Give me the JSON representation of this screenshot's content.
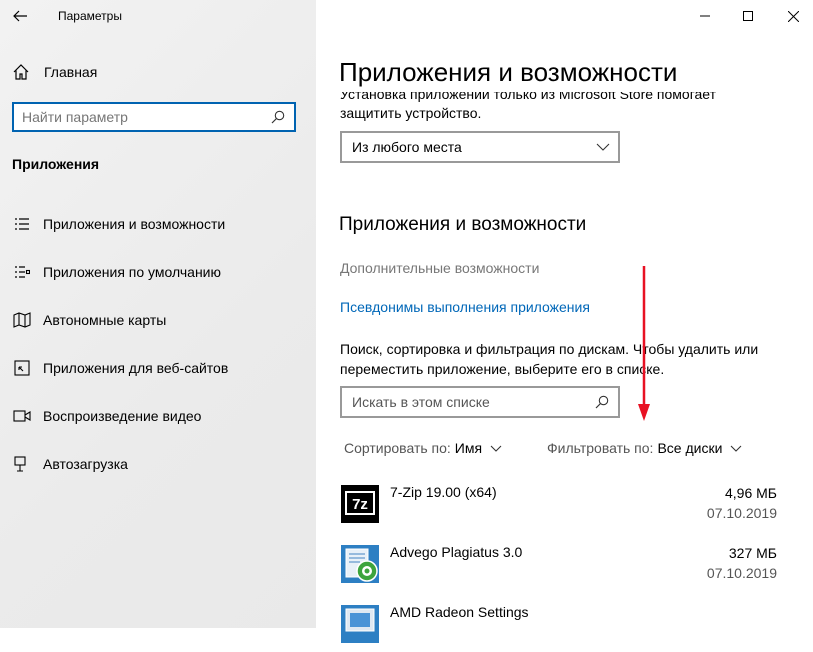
{
  "window": {
    "title": "Параметры"
  },
  "sidebar": {
    "home_label": "Главная",
    "search_placeholder": "Найти параметр",
    "section_title": "Приложения",
    "items": [
      {
        "label": "Приложения и возможности",
        "icon": "apps-list-icon"
      },
      {
        "label": "Приложения по умолчанию",
        "icon": "default-apps-icon"
      },
      {
        "label": "Автономные карты",
        "icon": "offline-maps-icon"
      },
      {
        "label": "Приложения для веб-сайтов",
        "icon": "apps-for-websites-icon"
      },
      {
        "label": "Воспроизведение видео",
        "icon": "video-playback-icon"
      },
      {
        "label": "Автозагрузка",
        "icon": "startup-icon"
      }
    ]
  },
  "main": {
    "page_title": "Приложения и возможности",
    "cut_line": "Установка приложений только из Microsoft Store помогает",
    "cut_line2": "защитить устройство.",
    "install_source_selected": "Из любого места",
    "subheading": "Приложения и возможности",
    "optional_features_link": "Дополнительные возможности",
    "execution_aliases_link": "Псевдонимы выполнения приложения",
    "description": "Поиск, сортировка и фильтрация по дискам. Чтобы удалить или переместить приложение, выберите его в списке.",
    "list_search_placeholder": "Искать в этом списке",
    "sort_label": "Сортировать по:",
    "sort_value": "Имя",
    "filter_label": "Фильтровать по:",
    "filter_value": "Все диски",
    "apps": [
      {
        "name": "7-Zip 19.00 (x64)",
        "size": "4,96 МБ",
        "date": "07.10.2019",
        "icon": "7zip-icon"
      },
      {
        "name": "Advego Plagiatus 3.0",
        "size": "327 МБ",
        "date": "07.10.2019",
        "icon": "advego-icon"
      },
      {
        "name": "AMD Radeon Settings",
        "size": "",
        "date": "",
        "icon": "amd-radeon-icon"
      }
    ]
  },
  "colors": {
    "accent": "#0063b1",
    "link": "#0067b8",
    "annotation_arrow": "#e81123"
  }
}
